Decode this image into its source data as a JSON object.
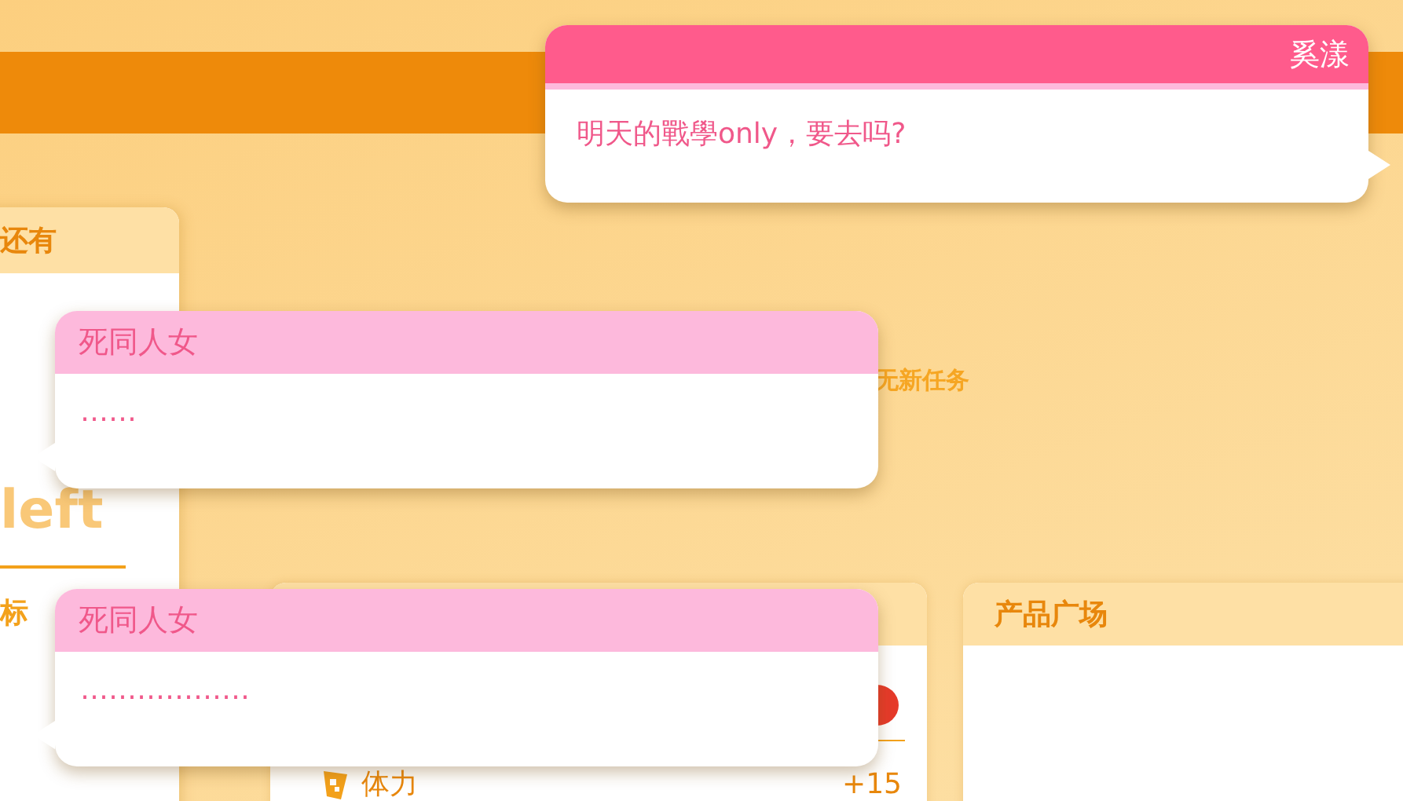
{
  "left_card": {
    "header": "还有",
    "unit": "left",
    "section": "标"
  },
  "tasks": {
    "empty_text": "无新任务"
  },
  "stats_card": {
    "rows": [
      {
        "label": "体力",
        "value": "+15"
      }
    ]
  },
  "product_card": {
    "title": "产品广场"
  },
  "chat_bubbles": [
    {
      "kind": "sent",
      "sender": "奚漾",
      "message": "明天的戰學only，要去吗?"
    },
    {
      "kind": "received",
      "sender": "死同人女",
      "message": "……"
    },
    {
      "kind": "received",
      "sender": "死同人女",
      "message": "………………"
    }
  ]
}
